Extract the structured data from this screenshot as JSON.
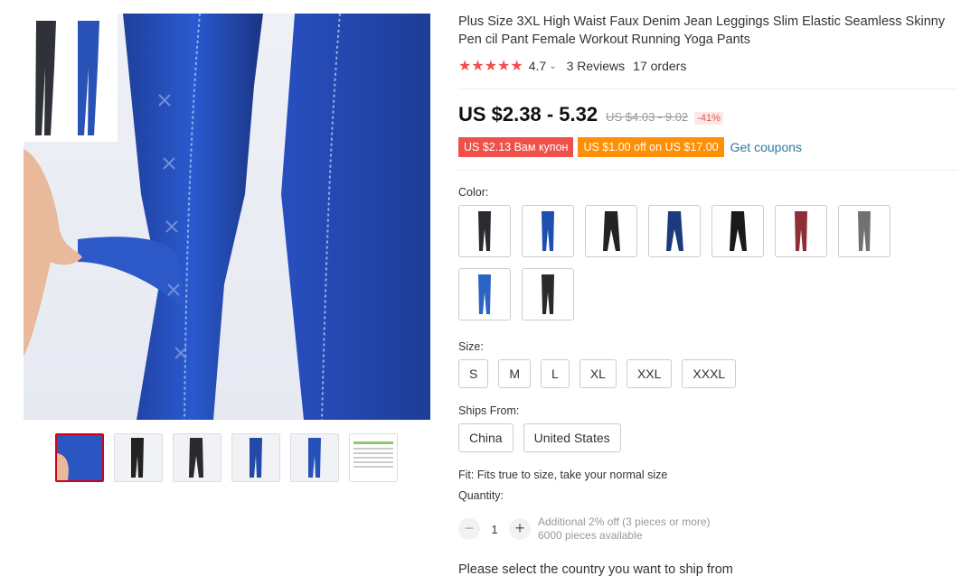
{
  "product": {
    "title": "Plus Size 3XL High Waist Faux Denim Jean Leggings Slim Elastic Seamless Skinny Pen cil Pant Female Workout Running Yoga Pants",
    "stars": "★★★★★",
    "rating": "4.7",
    "reviews": "3 Reviews",
    "orders": "17 orders",
    "price": "US $2.38 - 5.32",
    "old_price": "US $4.03 - 9.02",
    "discount": "-41%"
  },
  "coupons": {
    "coupon1": "US $2.13 Вам купон",
    "coupon2": "US $1.00 off on US $17.00",
    "get_coupons": "Get coupons"
  },
  "color": {
    "label": "Color:",
    "options": [
      {
        "name": "black",
        "color": "#2b2b30"
      },
      {
        "name": "blue",
        "color": "#1e4fb0"
      },
      {
        "name": "black-pattern",
        "color": "#232326"
      },
      {
        "name": "navy-pattern",
        "color": "#1c3a7c"
      },
      {
        "name": "black-lace",
        "color": "#1a1a1a"
      },
      {
        "name": "burgundy",
        "color": "#8e2f37"
      },
      {
        "name": "gray",
        "color": "#6f7173"
      },
      {
        "name": "light-blue",
        "color": "#2c64c5"
      },
      {
        "name": "dark",
        "color": "#2a2a2a"
      }
    ]
  },
  "size": {
    "label": "Size:",
    "options": [
      "S",
      "M",
      "L",
      "XL",
      "XXL",
      "XXXL"
    ]
  },
  "ships": {
    "label": "Ships From:",
    "options": [
      "China",
      "United States"
    ]
  },
  "fit": "Fit: Fits true to size, take your normal size",
  "quantity": {
    "label": "Quantity:",
    "minus": "−",
    "value": "1",
    "plus": "+",
    "offer": "Additional 2% off (3 pieces or more)",
    "available": "6000 pieces available"
  },
  "ship_message": "Please select the country you want to ship from"
}
